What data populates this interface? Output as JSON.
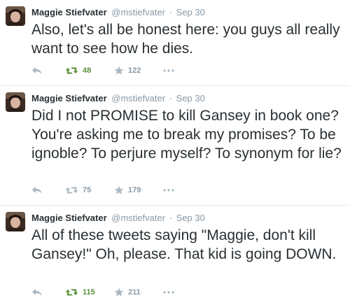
{
  "colors": {
    "retweet_active": "#5c913b",
    "muted": "#8899a6",
    "text": "#292f33",
    "divider": "#e1e8ed"
  },
  "tweets": [
    {
      "name": "Maggie Stiefvater",
      "handle": "@mstiefvater",
      "separator": "·",
      "time": "Sep 30",
      "text": "Also, let's all be honest here: you guys all really want to see how he dies.",
      "retweets": "48",
      "retweeted": true,
      "favorites": "122"
    },
    {
      "name": "Maggie Stiefvater",
      "handle": "@mstiefvater",
      "separator": "·",
      "time": "Sep 30",
      "text": "Did I not PROMISE to kill Gansey in book one? You're asking me to break my promises? To be ignoble? To perjure myself? To synonym for lie?",
      "retweets": "75",
      "retweeted": false,
      "favorites": "179"
    },
    {
      "name": "Maggie Stiefvater",
      "handle": "@mstiefvater",
      "separator": "·",
      "time": "Sep 30",
      "text": "All of these tweets saying \"Maggie, don't kill Gansey!\" Oh, please. That kid is going DOWN.",
      "retweets": "115",
      "retweeted": true,
      "favorites": "211"
    }
  ],
  "icons": [
    "avatar",
    "reply-icon",
    "retweet-icon",
    "favorite-star-icon",
    "more-options-icon"
  ]
}
